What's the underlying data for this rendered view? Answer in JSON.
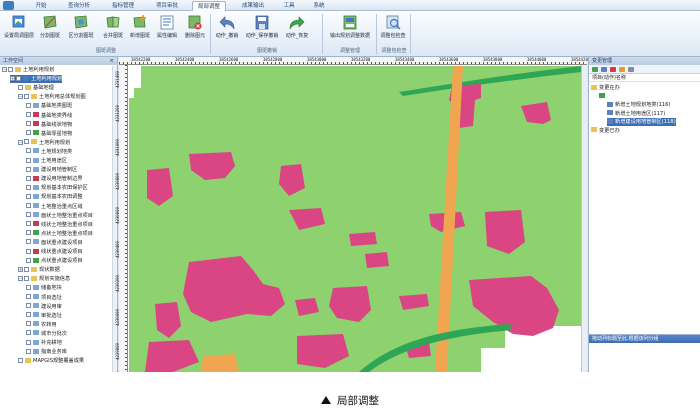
{
  "menu_tabs": [
    "开始",
    "查询分析",
    "指标管理",
    "项目审批",
    "局部调整",
    "成果输出",
    "工具",
    "系统"
  ],
  "active_tab": "局部调整",
  "ribbon": {
    "buttons": [
      {
        "label": "设置局调图层",
        "icon": "layers-icon"
      },
      {
        "label": "分割图斑",
        "icon": "split-polygon-icon"
      },
      {
        "label": "区分割图斑",
        "icon": "region-split-icon"
      },
      {
        "label": "合并图斑",
        "icon": "merge-polygon-icon"
      },
      {
        "label": "新增图斑",
        "icon": "add-polygon-icon"
      },
      {
        "label": "属性编辑",
        "icon": "attribute-edit-icon"
      },
      {
        "label": "删除图元",
        "icon": "delete-element-icon"
      },
      {
        "label": "动作_撤销",
        "icon": "undo-icon"
      },
      {
        "label": "动作_保存撤销",
        "icon": "save-icon"
      },
      {
        "label": "动作_恢复",
        "icon": "redo-icon"
      },
      {
        "label": "输出规划调整数据",
        "icon": "export-data-icon"
      },
      {
        "label": "调整包检查",
        "icon": "package-check-icon"
      }
    ],
    "groups": [
      "图斑调整",
      "图斑撤销",
      "调整管理",
      "调整包检查"
    ]
  },
  "left_panel": {
    "title": "工作空间",
    "close": "×",
    "tree": [
      {
        "label": "土地利用规划",
        "indent": 0,
        "expander": "−",
        "icon": "folder"
      },
      {
        "label": "土地利用规划",
        "indent": 1,
        "expander": "+",
        "icon": "map",
        "selected": true
      },
      {
        "label": "基础地理",
        "indent": 2,
        "expander": "",
        "icon": "folder"
      },
      {
        "label": "土地利用总体规划图",
        "indent": 2,
        "expander": "−",
        "icon": "folder"
      },
      {
        "label": "基础地类图斑",
        "indent": 3,
        "expander": "",
        "icon": "layer"
      },
      {
        "label": "基础地类界线",
        "indent": 3,
        "expander": "",
        "icon": "line"
      },
      {
        "label": "基础线状地物",
        "indent": 3,
        "expander": "",
        "icon": "line"
      },
      {
        "label": "基础零星地物",
        "indent": 3,
        "expander": "",
        "icon": "point"
      },
      {
        "label": "土地利用规划",
        "indent": 2,
        "expander": "−",
        "icon": "folder"
      },
      {
        "label": "土地规划地类",
        "indent": 3,
        "expander": "",
        "icon": "layer"
      },
      {
        "label": "土地用途区",
        "indent": 3,
        "expander": "",
        "icon": "layer"
      },
      {
        "label": "建设用地管制区",
        "indent": 3,
        "expander": "",
        "icon": "layer"
      },
      {
        "label": "建设用地管制边界",
        "indent": 3,
        "expander": "",
        "icon": "line"
      },
      {
        "label": "规划基本农田保护区",
        "indent": 3,
        "expander": "",
        "icon": "layer"
      },
      {
        "label": "规划基本农田调整",
        "indent": 3,
        "expander": "",
        "icon": "layer"
      },
      {
        "label": "土地整治重点区域",
        "indent": 3,
        "expander": "",
        "icon": "layer"
      },
      {
        "label": "面状土地整治重点项目",
        "indent": 3,
        "expander": "",
        "icon": "layer"
      },
      {
        "label": "线状土地整治重点项目",
        "indent": 3,
        "expander": "",
        "icon": "line"
      },
      {
        "label": "点状土地整治重点项目",
        "indent": 3,
        "expander": "",
        "icon": "point"
      },
      {
        "label": "面状重点建设项目",
        "indent": 3,
        "expander": "",
        "icon": "layer"
      },
      {
        "label": "线状重点建设项目",
        "indent": 3,
        "expander": "",
        "icon": "line"
      },
      {
        "label": "点状重点建设项目",
        "indent": 3,
        "expander": "",
        "icon": "point"
      },
      {
        "label": "现状数据",
        "indent": 2,
        "expander": "+",
        "icon": "folder"
      },
      {
        "label": "规划实施信息",
        "indent": 2,
        "expander": "−",
        "icon": "folder"
      },
      {
        "label": "储备地块",
        "indent": 3,
        "expander": "",
        "icon": "layer"
      },
      {
        "label": "项目选址",
        "indent": 3,
        "expander": "",
        "icon": "layer"
      },
      {
        "label": "建设用审",
        "indent": 3,
        "expander": "",
        "icon": "layer"
      },
      {
        "label": "审批选址",
        "indent": 3,
        "expander": "",
        "icon": "layer"
      },
      {
        "label": "农转用",
        "indent": 3,
        "expander": "",
        "icon": "layer"
      },
      {
        "label": "城市分批次",
        "indent": 3,
        "expander": "",
        "icon": "layer"
      },
      {
        "label": "补充耕地",
        "indent": 3,
        "expander": "",
        "icon": "layer"
      },
      {
        "label": "指南业务库",
        "indent": 3,
        "expander": "",
        "icon": "layer"
      },
      {
        "label": "MAPGIS规整覆盖成果",
        "indent": 2,
        "expander": "",
        "icon": "folder"
      }
    ]
  },
  "map": {
    "ruler_top_labels": [
      "38542200",
      "38542400",
      "38542600",
      "38542800",
      "38543000",
      "38543200",
      "38543400",
      "38543600",
      "38543800",
      "38544000",
      "38544200"
    ],
    "ruler_left_labels": [
      "4231400",
      "4231200",
      "4231000",
      "4230800",
      "4230600",
      "4230400",
      "4230200",
      "4230000",
      "4229800"
    ],
    "colors": {
      "background": "#8ed16f",
      "pink": "#d94683",
      "orange": "#f0a650",
      "green": "#2ea655",
      "white": "#ffffff"
    }
  },
  "right_panel": {
    "title": "变更管理",
    "list_header": "项目(动作)名称",
    "items": [
      {
        "label": "变更在办",
        "indent": 0
      },
      {
        "label": "",
        "indent": 1
      },
      {
        "label": "新增土地规划地类(116)",
        "indent": 2
      },
      {
        "label": "新增土地用途区(117)",
        "indent": 2
      },
      {
        "label": "新增建设用地管制区(118)",
        "indent": 2,
        "selected": true
      },
      {
        "label": "变更已办",
        "indent": 0
      }
    ],
    "bottom_title": "拖动列标题至此,根据该列分组"
  },
  "caption": "局部调整"
}
